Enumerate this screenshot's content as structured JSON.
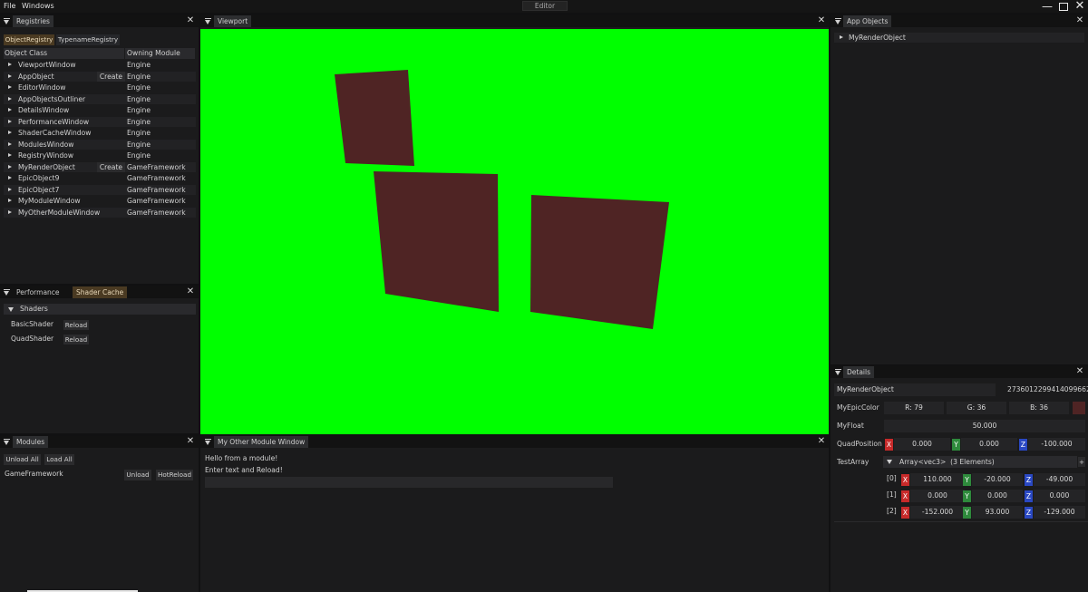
{
  "menubar": {
    "file": "File",
    "windows": "Windows",
    "title": "Editor"
  },
  "registries": {
    "tab": "Registries",
    "subtabs": [
      "ObjectRegistry",
      "TypenameRegistry"
    ],
    "columns": [
      "Object Class",
      "Owning Module"
    ],
    "rows": [
      {
        "name": "ViewportWindow",
        "module": "Engine",
        "create": ""
      },
      {
        "name": "AppObject",
        "module": "Engine",
        "create": "Create"
      },
      {
        "name": "EditorWindow",
        "module": "Engine",
        "create": ""
      },
      {
        "name": "AppObjectsOutliner",
        "module": "Engine",
        "create": ""
      },
      {
        "name": "DetailsWindow",
        "module": "Engine",
        "create": ""
      },
      {
        "name": "PerformanceWindow",
        "module": "Engine",
        "create": ""
      },
      {
        "name": "ShaderCacheWindow",
        "module": "Engine",
        "create": ""
      },
      {
        "name": "ModulesWindow",
        "module": "Engine",
        "create": ""
      },
      {
        "name": "RegistryWindow",
        "module": "Engine",
        "create": ""
      },
      {
        "name": "MyRenderObject",
        "module": "GameFramework",
        "create": "Create"
      },
      {
        "name": "EpicObject9",
        "module": "GameFramework",
        "create": ""
      },
      {
        "name": "EpicObject7",
        "module": "GameFramework",
        "create": ""
      },
      {
        "name": "MyModuleWindow",
        "module": "GameFramework",
        "create": ""
      },
      {
        "name": "MyOtherModuleWindow",
        "module": "GameFramework",
        "create": ""
      }
    ]
  },
  "shader_panel": {
    "tabs": [
      "Performance",
      "Shader Cache"
    ],
    "header": "Shaders",
    "shaders": [
      {
        "name": "BasicShader",
        "action": "Reload"
      },
      {
        "name": "QuadShader",
        "action": "Reload"
      }
    ]
  },
  "modules": {
    "tab": "Modules",
    "unload_all": "Unload All",
    "load_all": "Load All",
    "items": [
      {
        "name": "GameFramework",
        "unload": "Unload",
        "hotreload": "HotReload"
      }
    ]
  },
  "viewport": {
    "tab": "Viewport",
    "background": "#00ff00",
    "quad_color": "#4f2424"
  },
  "other_module": {
    "tab": "My Other Module Window",
    "line1": "Hello from a module!",
    "line2": "Enter text and Reload!",
    "input_value": ""
  },
  "app_objects": {
    "tab": "App Objects",
    "items": [
      "MyRenderObject"
    ]
  },
  "details": {
    "tab": "Details",
    "object_name": "MyRenderObject",
    "object_id": "2736012299414099662",
    "color": {
      "label": "MyEpicColor",
      "r": "R: 79",
      "g": "G: 36",
      "b": "B: 36",
      "swatch": "#4f2424"
    },
    "float": {
      "label": "MyFloat",
      "value": "50.000"
    },
    "quad_position": {
      "label": "QuadPosition",
      "x": "0.000",
      "y": "0.000",
      "z": "-100.000"
    },
    "test_array": {
      "label": "TestArray",
      "header": "Array<vec3>  (3 Elements)",
      "plus": "+",
      "rows": [
        {
          "index": "[0]",
          "x": "110.000",
          "y": "-20.000",
          "z": "-49.000"
        },
        {
          "index": "[1]",
          "x": "0.000",
          "y": "0.000",
          "z": "0.000"
        },
        {
          "index": "[2]",
          "x": "-152.000",
          "y": "93.000",
          "z": "-129.000"
        }
      ]
    },
    "axes": {
      "x": "X",
      "y": "Y",
      "z": "Z"
    }
  }
}
